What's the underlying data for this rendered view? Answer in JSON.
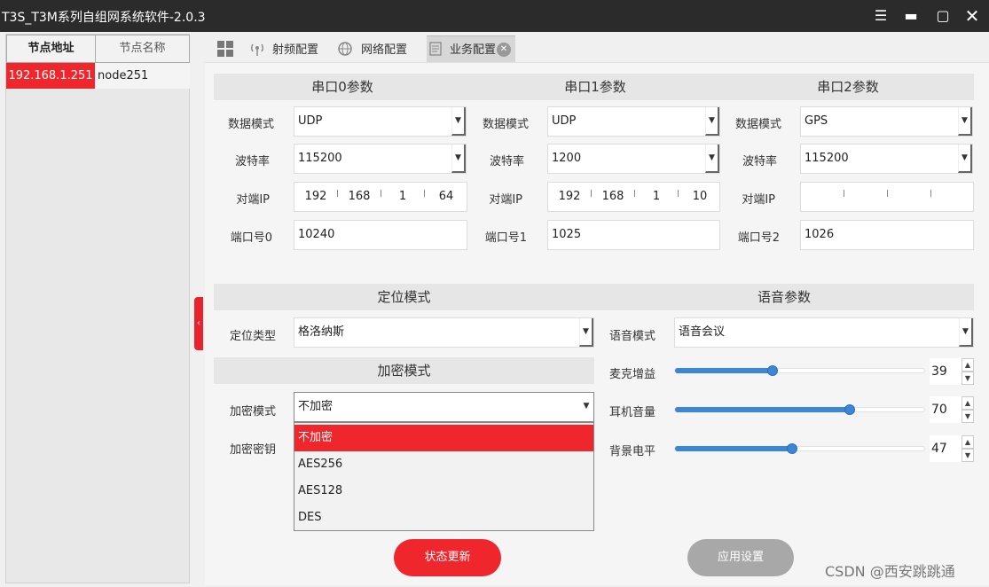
{
  "window": {
    "title": "T3S_T3M系列自组网系统软件-2.0.3",
    "menu_icon": "menu-icon",
    "min_icon": "minimize-icon",
    "max_icon": "maximize-icon",
    "close_icon": "close-icon"
  },
  "node_table": {
    "headers": [
      "节点地址",
      "节点名称"
    ],
    "rows": [
      {
        "address": "192.168.1.251",
        "name": "node251"
      }
    ],
    "selected_color": "#f0262d"
  },
  "tabs": [
    {
      "label": "",
      "icon": "grid-icon"
    },
    {
      "label": "射频配置",
      "icon": "antenna-icon"
    },
    {
      "label": "网络配置",
      "icon": "globe-icon"
    },
    {
      "label": "业务配置",
      "icon": "document-icon",
      "active": true,
      "closable": true
    }
  ],
  "serial": [
    {
      "title": "串口0参数",
      "mode_label": "数据模式",
      "mode": "UDP",
      "baud_label": "波特率",
      "baud": "115200",
      "ip_label": "对端IP",
      "ip": [
        "192",
        "168",
        "1",
        "64"
      ],
      "port_label": "端口号0",
      "port": "10240"
    },
    {
      "title": "串口1参数",
      "mode_label": "数据模式",
      "mode": "UDP",
      "baud_label": "波特率",
      "baud": "1200",
      "ip_label": "对端IP",
      "ip": [
        "192",
        "168",
        "1",
        "10"
      ],
      "port_label": "端口号1",
      "port": "1025"
    },
    {
      "title": "串口2参数",
      "mode_label": "数据模式",
      "mode": "GPS",
      "baud_label": "波特率",
      "baud": "115200",
      "ip_label": "对端IP",
      "ip": [
        "",
        "",
        "",
        ""
      ],
      "port_label": "端口号2",
      "port": "1026"
    }
  ],
  "positioning": {
    "title": "定位模式",
    "type_label": "定位类型",
    "type": "格洛纳斯"
  },
  "encryption": {
    "title": "加密模式",
    "mode_label": "加密模式",
    "mode": "不加密",
    "key_label": "加密密钥",
    "options": [
      "不加密",
      "AES256",
      "AES128",
      "DES"
    ],
    "selected_index": 0
  },
  "voice": {
    "title": "语音参数",
    "mode_label": "语音模式",
    "mode": "语音会议",
    "mic_label": "麦克增益",
    "mic_value": "39",
    "mic_level": 39,
    "ear_label": "耳机音量",
    "ear_value": "70",
    "ear_level": 70,
    "bg_label": "背景电平",
    "bg_value": "47",
    "bg_level": 47
  },
  "buttons": {
    "status": "状态更新",
    "apply": "应用设置"
  },
  "colors": {
    "accent": "#f0262d",
    "slider": "#3b86d6",
    "disabled": "#a8a8a8",
    "titlebar": "#2b2b2b"
  },
  "watermark": "CSDN @西安跳跳通"
}
